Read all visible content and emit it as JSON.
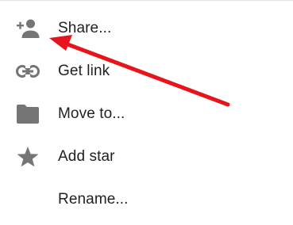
{
  "menu": {
    "items": [
      {
        "label": "Share...",
        "icon": "add-person-icon"
      },
      {
        "label": "Get link",
        "icon": "link-icon"
      },
      {
        "label": "Move to...",
        "icon": "folder-icon"
      },
      {
        "label": "Add star",
        "icon": "star-icon"
      },
      {
        "label": "Rename...",
        "icon": ""
      }
    ]
  },
  "colors": {
    "icon": "#757575",
    "text": "#202124",
    "annotation_arrow": "#e8141b"
  }
}
